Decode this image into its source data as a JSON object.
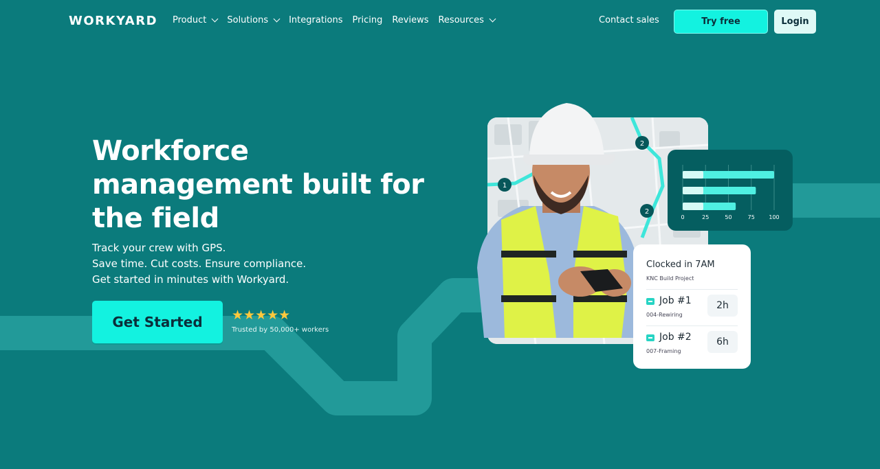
{
  "brand": {
    "logo_text": "WORKYARD"
  },
  "nav": {
    "items": [
      {
        "label": "Product",
        "has_dropdown": true
      },
      {
        "label": "Solutions",
        "has_dropdown": true
      },
      {
        "label": "Integrations",
        "has_dropdown": false
      },
      {
        "label": "Pricing",
        "has_dropdown": false
      },
      {
        "label": "Reviews",
        "has_dropdown": false
      },
      {
        "label": "Resources",
        "has_dropdown": true
      }
    ],
    "contact_sales": "Contact sales",
    "try_free": "Try free",
    "login": "Login"
  },
  "hero": {
    "title_lines": [
      "Workforce",
      "management built for",
      "the field"
    ],
    "subtitle_lines": [
      "Track your crew with GPS.",
      "Save time. Cut costs. Ensure compliance.",
      "Get started in minutes with Workyard."
    ],
    "cta": "Get Started",
    "rating": {
      "stars": 5,
      "stars_text": "★★★★★",
      "label": "Trusted by 50,000+ workers"
    }
  },
  "map_card": {
    "pins": [
      "1",
      "2",
      "2"
    ]
  },
  "chart_card": {
    "chart_data": {
      "type": "bar",
      "orientation": "horizontal",
      "categories": [
        "",
        "",
        ""
      ],
      "values": [
        100,
        80,
        58
      ],
      "xlim": [
        0,
        100
      ],
      "xticks": [
        "0",
        "25",
        "50",
        "75",
        "100"
      ]
    }
  },
  "clock_card": {
    "title": "Clocked in 7AM",
    "project": "KNC Build Project",
    "jobs": [
      {
        "name": "Job #1",
        "code": "004-Rewiring",
        "hours": "2h"
      },
      {
        "name": "Job #2",
        "code": "007-Framing",
        "hours": "6h"
      }
    ]
  },
  "colors": {
    "background": "#0b7b7c",
    "accent": "#13f2e0",
    "card_dark": "#055e60",
    "stars": "#ffc83d"
  }
}
